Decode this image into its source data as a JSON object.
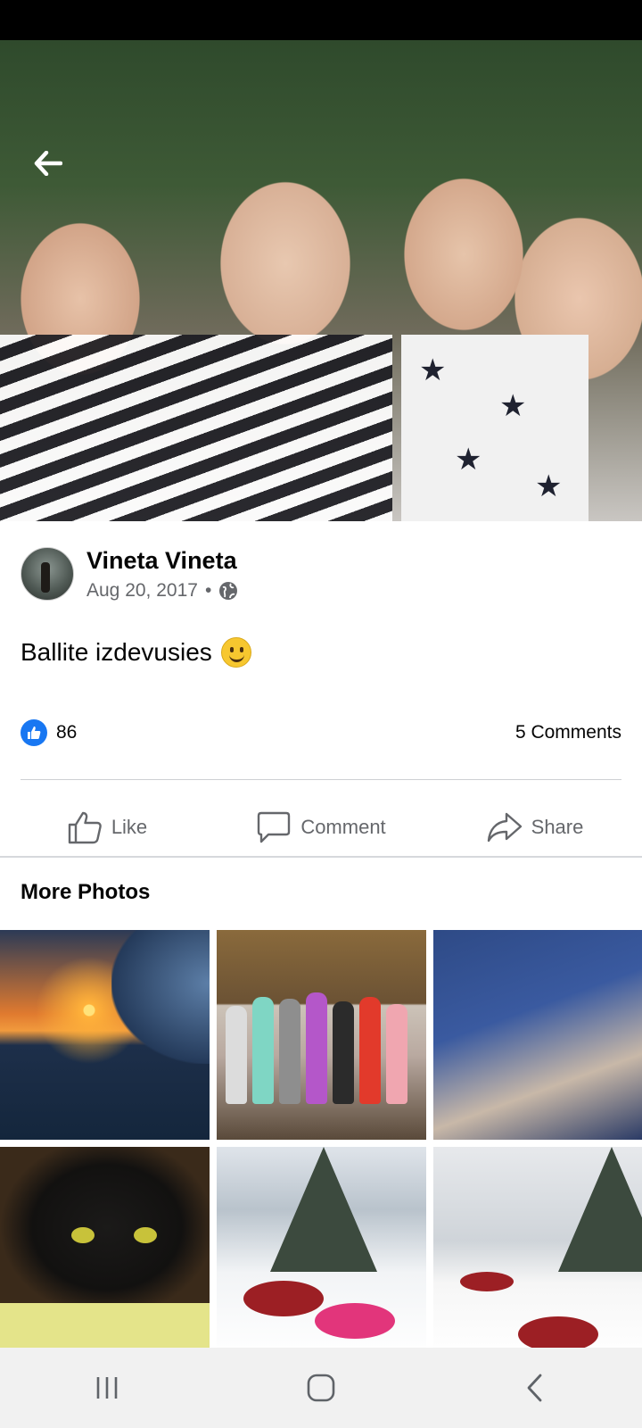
{
  "post": {
    "author": "Vineta Vineta",
    "date": "Aug 20, 2017",
    "separator": "•",
    "privacy_icon": "globe-icon",
    "caption": "Ballite izdevusies",
    "caption_emoji": "slightly-smiling-face-emoji"
  },
  "reactions": {
    "like_count": "86",
    "comments": "5 Comments"
  },
  "actions": {
    "like": "Like",
    "comment": "Comment",
    "share": "Share"
  },
  "more_photos": {
    "title": "More Photos",
    "photos": [
      "sunset-wave-photo",
      "party-group-photo",
      "bus-selfie-photo",
      "black-cat-photo",
      "snow-tubing-photo",
      "snow-slide-photo"
    ]
  },
  "colors": {
    "facebook_blue": "#1877f2",
    "secondary_text": "#65676b",
    "divider": "#ced0d4"
  }
}
